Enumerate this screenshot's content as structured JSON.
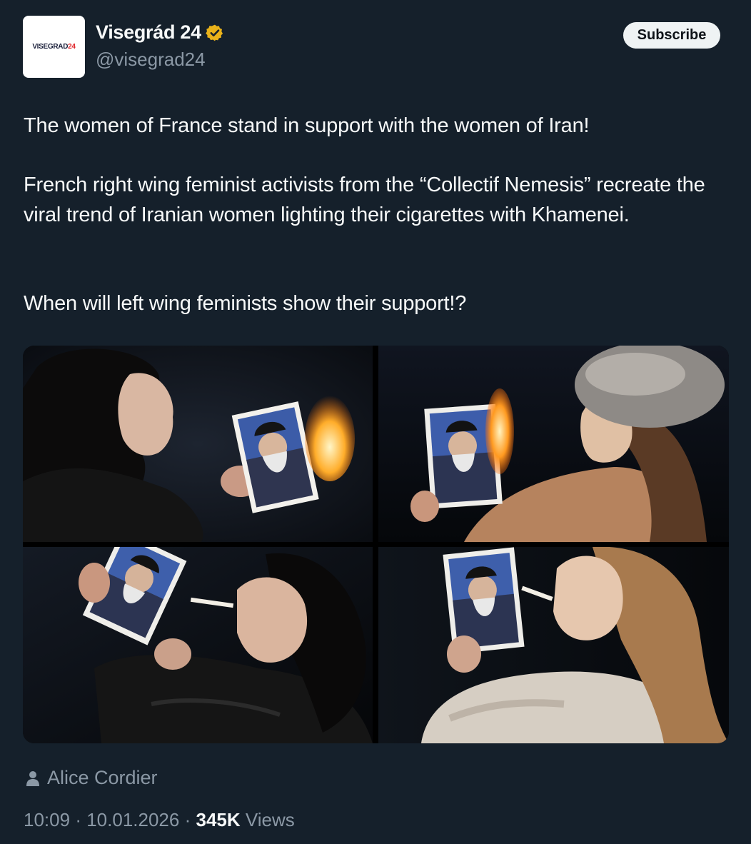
{
  "account": {
    "avatar_logo_text": "VISEGRAD",
    "avatar_logo_number": "24",
    "display_name": "Visegrád 24",
    "handle": "@visegrad24",
    "verified_color": "#e9b21a"
  },
  "subscribe_label": "Subscribe",
  "tweet": {
    "paragraph_1": "The women of France stand in support with the women of Iran!",
    "paragraph_2": "French right wing feminist activists from the “Collectif Nemesis” recreate the viral trend of Iranian women lighting their cigarettes with Khamenei.",
    "paragraph_3": "When will left wing feminists show their support!?"
  },
  "media": {
    "count": 4,
    "photos": [
      "photo-top-left",
      "photo-top-right",
      "photo-bottom-left",
      "photo-bottom-right"
    ]
  },
  "footer": {
    "author_icon": "person-icon",
    "author": "Alice Cordier",
    "time": "10:09",
    "separator": "·",
    "date": "10.01.2026",
    "views_count": "345K",
    "views_label": "Views"
  },
  "colors": {
    "background": "#15202b",
    "text_primary": "#f7f9f9",
    "text_secondary": "#8b98a5",
    "button_bg": "#eff3f4"
  }
}
